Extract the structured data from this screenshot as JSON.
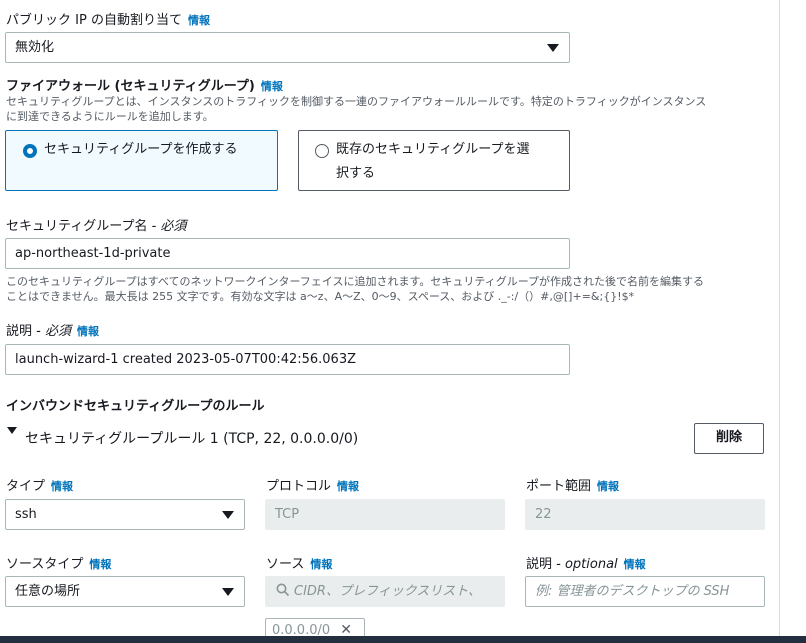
{
  "public_ip": {
    "label": "パブリック IP の自動割り当て",
    "info": "情報",
    "value": "無効化"
  },
  "firewall": {
    "title": "ファイアウォール (セキュリティグループ)",
    "info": "情報",
    "description_line1": "セキュリティグループとは、インスタンスのトラフィックを制御する一連のファイアウォールルールです。特定のトラフィックがインスタンス",
    "description_line2": "に到達できるようにルールを追加します。",
    "option_create": "セキュリティグループを作成する",
    "option_existing_line1": "既存のセキュリティグループを選",
    "option_existing_line2": "択する"
  },
  "sg_name": {
    "label": "セキュリティグループ名",
    "required": "- 必須",
    "value": "ap-northeast-1d-private",
    "hint_line1": "このセキュリティグループはすべてのネットワークインターフェイスに追加されます。セキュリティグループが作成された後で名前を編集する",
    "hint_line2": "ことはできません。最大長は 255 文字です。有効な文字は a〜z、A〜Z、0〜9、スペース、および ._-:/（）#,@[]+=&;{}!$*"
  },
  "sg_desc": {
    "label": "説明",
    "required": "- 必須",
    "info": "情報",
    "value": "launch-wizard-1 created 2023-05-07T00:42:56.063Z"
  },
  "inbound": {
    "title": "インバウンドセキュリティグループのルール",
    "rule_title": "セキュリティグループルール 1 (TCP, 22, 0.0.0.0/0)",
    "delete_button": "削除",
    "type_label": "タイプ",
    "type_value": "ssh",
    "protocol_label": "プロトコル",
    "protocol_value": "TCP",
    "port_label": "ポート範囲",
    "port_value": "22",
    "source_type_label": "ソースタイプ",
    "source_type_value": "任意の場所",
    "source_label": "ソース",
    "source_placeholder": "CIDR、プレフィックスリスト、",
    "source_token": "0.0.0.0/0",
    "desc_label": "説明",
    "desc_optional": "- optional",
    "desc_placeholder": "例: 管理者のデスクトップの SSH",
    "info": "情報"
  }
}
